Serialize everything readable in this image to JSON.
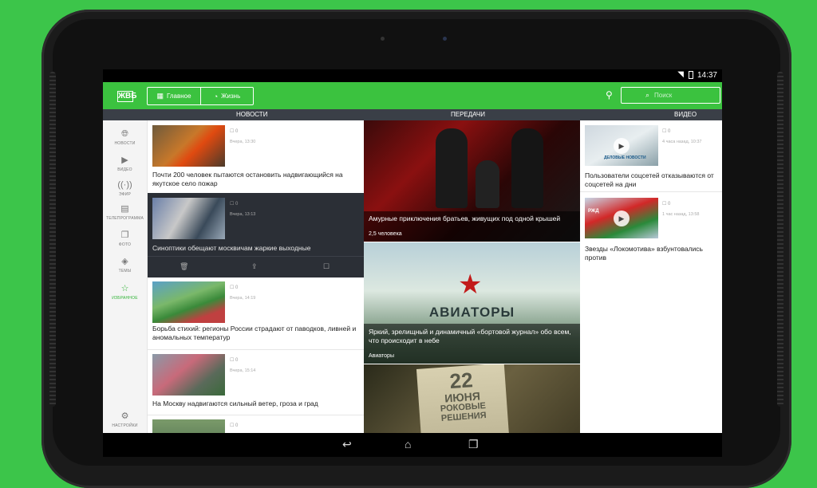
{
  "status": {
    "time": "14:37"
  },
  "header": {
    "logo": "ЖВБ",
    "tabs": [
      {
        "label": "Главное"
      },
      {
        "label": "Жизнь"
      }
    ],
    "search_placeholder": "Поиск"
  },
  "columns": [
    "НОВОСТИ",
    "ПЕРЕДАЧИ",
    "ВИДЕО"
  ],
  "nav": [
    {
      "label": "НОВОСТИ",
      "icon": "globe-icon"
    },
    {
      "label": "ВИДЕО",
      "icon": "play-icon"
    },
    {
      "label": "ЭФИР",
      "icon": "broadcast-icon"
    },
    {
      "label": "ТЕЛЕПРОГРАММА",
      "icon": "calendar-icon"
    },
    {
      "label": "ФОТО",
      "icon": "photo-icon"
    },
    {
      "label": "ТЕМЫ",
      "icon": "tag-icon"
    },
    {
      "label": "ИЗБРАННОЕ",
      "icon": "star-icon"
    },
    {
      "label": "НАСТРОЙКИ",
      "icon": "gear-icon"
    }
  ],
  "news": [
    {
      "comments": "0",
      "time": "Вчера, 13:30",
      "title": "Почти 200 человек пытаются остановить надвигающийся на якутское село пожар"
    },
    {
      "comments": "0",
      "time": "Вчера, 13:13",
      "title": "Синоптики обещают москвичам жаркие выходные"
    },
    {
      "comments": "0",
      "time": "Вчера, 14:19",
      "title": "Борьба стихий: регионы России страдают от паводков, ливней и аномальных температур"
    },
    {
      "comments": "0",
      "time": "Вчера, 15:14",
      "title": "На Москву надвигаются сильный ветер, гроза и град"
    },
    {
      "comments": "0",
      "time": "",
      "title": ""
    }
  ],
  "shows": [
    {
      "title": "Амурные приключения братьев, живущих под одной крышей",
      "sub": "2,5 человека"
    },
    {
      "title": "Яркий, зрелищный и динамичный «бортовой журнал» обо всем, что происходит в небе",
      "sub": "Авиаторы",
      "logo": "АВИАТОРЫ"
    },
    {
      "poster": [
        "22",
        "ИЮНЯ",
        "РОКОВЫЕ",
        "РЕШЕНИЯ"
      ]
    }
  ],
  "videos": [
    {
      "comments": "0",
      "time": "4 часа назад, 10:37",
      "title": "Пользователи соцсетей отказываются от соцсетей на дни",
      "thumb_text": "ДЕЛОВЫЕ НОВОСТИ"
    },
    {
      "comments": "0",
      "time": "1 час назад, 13:58",
      "title": "Звезды «Локомотива» взбунтовались против",
      "thumb_text": "РЖД"
    }
  ]
}
